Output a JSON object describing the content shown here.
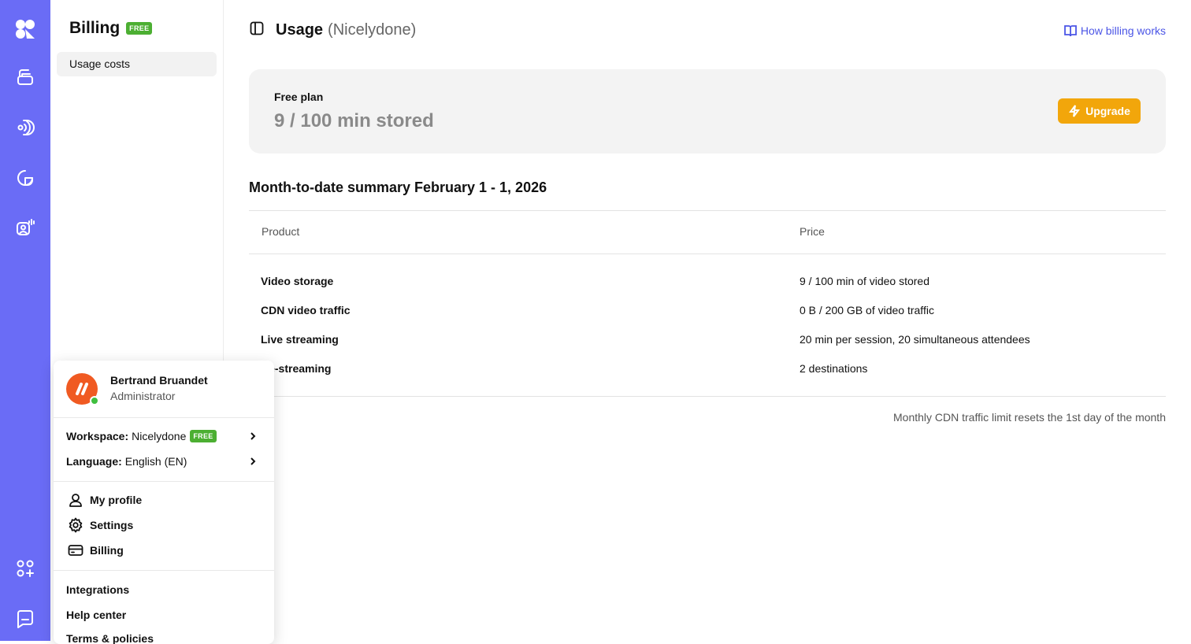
{
  "rail": {
    "icons": [
      "logo-icon",
      "library-icon",
      "live-icon",
      "analytics-icon",
      "studio-icon",
      "apps-icon",
      "chat-icon"
    ]
  },
  "sidebar": {
    "title": "Billing",
    "badge": "FREE",
    "items": [
      {
        "label": "Usage costs"
      }
    ]
  },
  "header": {
    "title": "Usage",
    "subtitle": "(Nicelydone)",
    "help_link": "How billing works"
  },
  "plan": {
    "label": "Free plan",
    "value": "9 / 100 min stored",
    "upgrade_label": "Upgrade"
  },
  "summary": {
    "title": "Month-to-date summary February 1 - 1, 2026",
    "columns": [
      "Product",
      "Price"
    ],
    "rows": [
      {
        "product": "Video storage",
        "price": "9 / 100 min of video stored"
      },
      {
        "product": "CDN video traffic",
        "price": "0 B / 200 GB of video traffic"
      },
      {
        "product": "Live streaming",
        "price": "20 min per session, 20 simultaneous attendees"
      },
      {
        "product": "Re-streaming",
        "price": "2 destinations"
      }
    ],
    "note": "Monthly CDN traffic limit resets the 1st day of the month"
  },
  "user_menu": {
    "name": "Bertrand Bruandet",
    "role": "Administrator",
    "workspace_label": "Workspace:",
    "workspace_value": "Nicelydone",
    "workspace_badge": "FREE",
    "language_label": "Language:",
    "language_value": "English (EN)",
    "items": [
      {
        "label": "My profile",
        "icon": "user-icon"
      },
      {
        "label": "Settings",
        "icon": "gear-icon"
      },
      {
        "label": "Billing",
        "icon": "credit-card-icon"
      }
    ],
    "links": [
      "Integrations",
      "Help center",
      "Terms & policies"
    ]
  },
  "colors": {
    "rail": "#6a6cf6",
    "accent_link": "#4b55e6",
    "upgrade": "#f2a60b",
    "free_badge": "#4caf32",
    "avatar": "#f05a22"
  }
}
